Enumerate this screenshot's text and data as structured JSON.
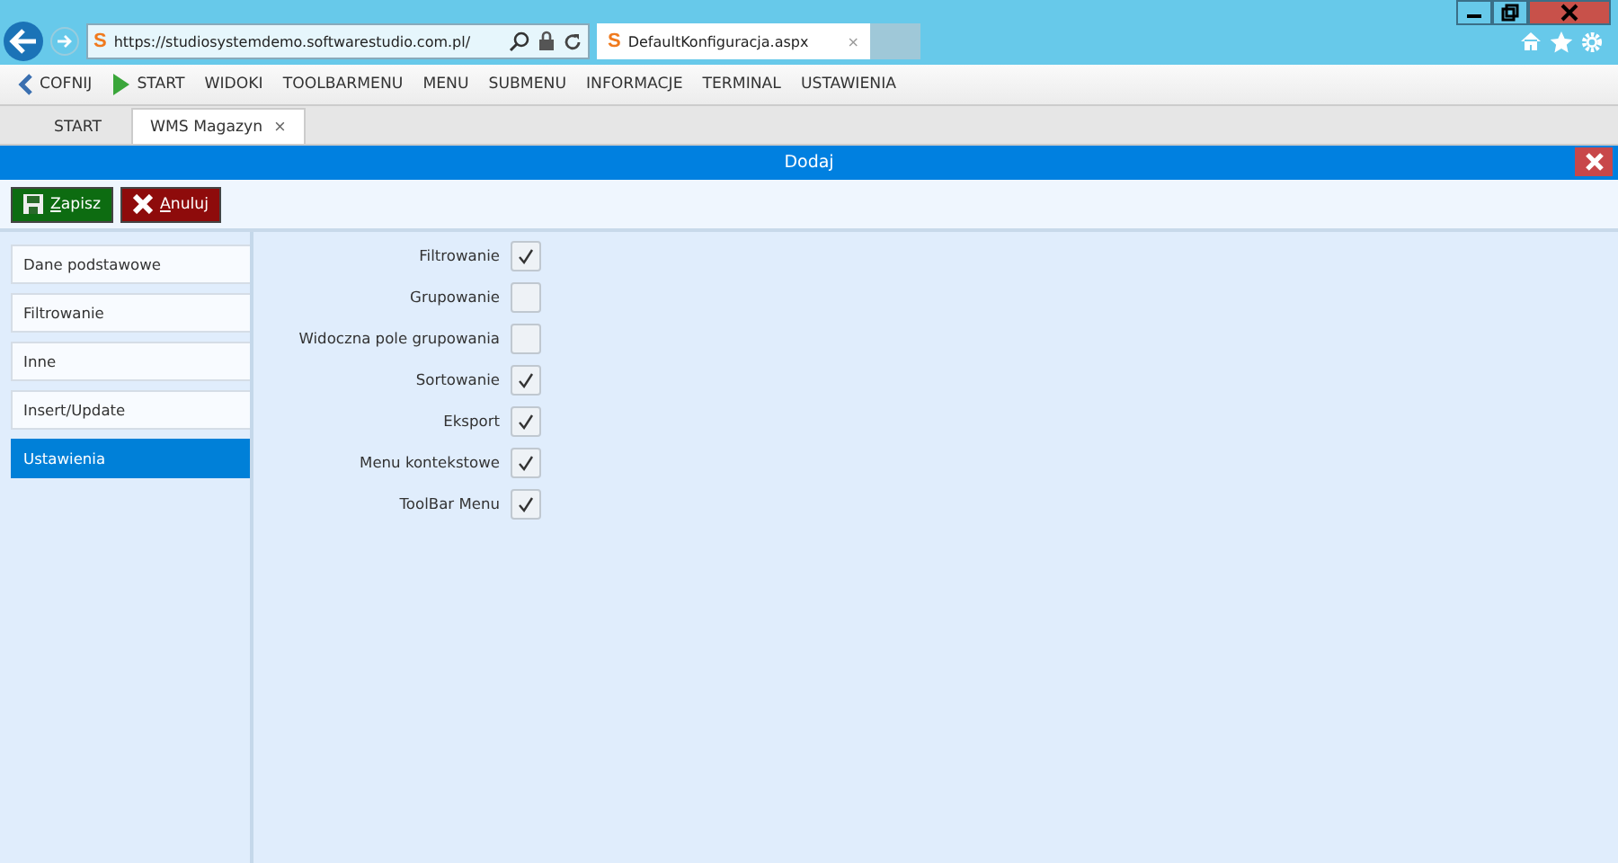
{
  "browser": {
    "logo": "S",
    "url": "https://studiosystemdemo.softwarestudio.com.pl/",
    "tab_logo": "S",
    "tab_title": "DefaultKonfiguracja.aspx",
    "tab_close": "×"
  },
  "menu": [
    {
      "label": "COFNIJ",
      "kind": "back"
    },
    {
      "label": "START",
      "kind": "play"
    },
    {
      "label": "WIDOKI",
      "kind": "plain"
    },
    {
      "label": "TOOLBARMENU",
      "kind": "plain"
    },
    {
      "label": "MENU",
      "kind": "plain"
    },
    {
      "label": "SUBMENU",
      "kind": "plain"
    },
    {
      "label": "INFORMACJE",
      "kind": "plain"
    },
    {
      "label": "TERMINAL",
      "kind": "plain"
    },
    {
      "label": "USTAWIENIA",
      "kind": "plain"
    }
  ],
  "page_tabs": [
    {
      "label": "START",
      "selected": false
    },
    {
      "label": "WMS Magazyn",
      "selected": true,
      "close": "×"
    }
  ],
  "dialog": {
    "title": "Dodaj"
  },
  "buttons": [
    {
      "label": "Zapisz",
      "kind": "save"
    },
    {
      "label": "Anuluj",
      "kind": "cancel"
    }
  ],
  "sections": [
    {
      "label": "Dane podstawowe",
      "selected": false
    },
    {
      "label": "Filtrowanie",
      "selected": false
    },
    {
      "label": "Inne",
      "selected": false
    },
    {
      "label": "Insert/Update",
      "selected": false
    },
    {
      "label": "Ustawienia",
      "selected": true
    }
  ],
  "options": [
    {
      "label": "Filtrowanie",
      "checked": true
    },
    {
      "label": "Grupowanie",
      "checked": false
    },
    {
      "label": "Widoczna pole grupowania",
      "checked": false
    },
    {
      "label": "Sortowanie",
      "checked": true
    },
    {
      "label": "Eksport",
      "checked": true
    },
    {
      "label": "Menu kontekstowe",
      "checked": true
    },
    {
      "label": "ToolBar Menu",
      "checked": true
    }
  ]
}
